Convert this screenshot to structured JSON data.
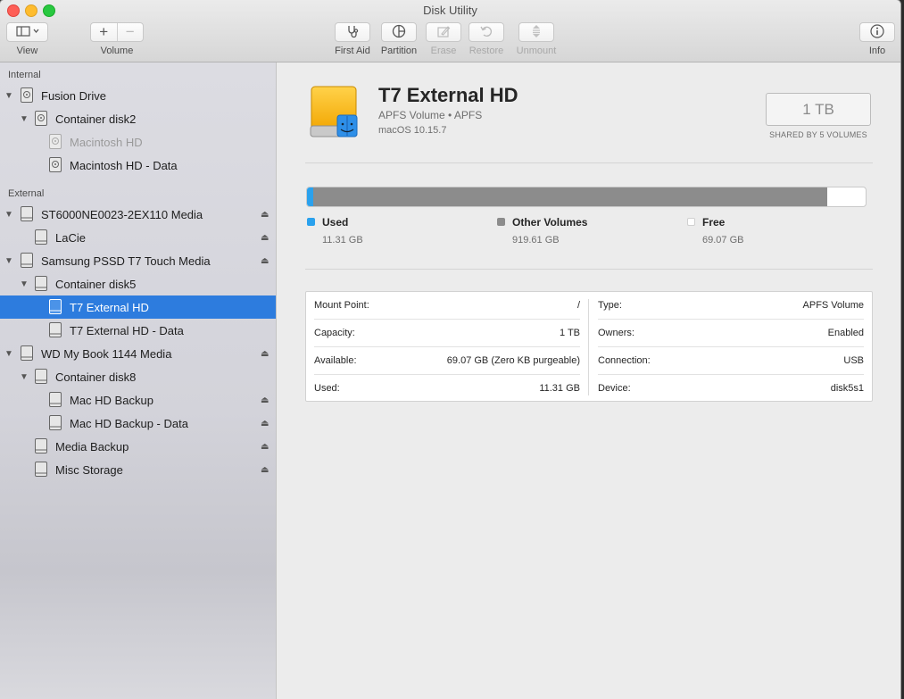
{
  "window": {
    "title": "Disk Utility"
  },
  "toolbar": {
    "view_label": "View",
    "volume_label": "Volume",
    "first_aid_label": "First Aid",
    "partition_label": "Partition",
    "erase_label": "Erase",
    "restore_label": "Restore",
    "unmount_label": "Unmount",
    "info_label": "Info"
  },
  "sidebar": {
    "internal_header": "Internal",
    "external_header": "External",
    "items": [
      {
        "label": "Fusion Drive"
      },
      {
        "label": "Container disk2"
      },
      {
        "label": "Macintosh HD"
      },
      {
        "label": "Macintosh HD - Data"
      },
      {
        "label": "ST6000NE0023-2EX110 Media"
      },
      {
        "label": "LaCie"
      },
      {
        "label": "Samsung PSSD T7 Touch Media"
      },
      {
        "label": "Container disk5"
      },
      {
        "label": "T7 External HD"
      },
      {
        "label": "T7 External HD - Data"
      },
      {
        "label": "WD My Book 1144 Media"
      },
      {
        "label": "Container disk8"
      },
      {
        "label": "Mac HD Backup"
      },
      {
        "label": "Mac HD Backup - Data"
      },
      {
        "label": "Media Backup"
      },
      {
        "label": "Misc Storage"
      }
    ]
  },
  "volume": {
    "name": "T7 External HD",
    "subtitle": "APFS Volume • APFS",
    "os": "macOS 10.15.7",
    "size": "1 TB",
    "shared": "SHARED BY 5 VOLUMES"
  },
  "usage": {
    "used": {
      "label": "Used",
      "value": "11.31 GB",
      "fraction": 0.0113,
      "color": "#2aa1ed"
    },
    "other": {
      "label": "Other Volumes",
      "value": "919.61 GB",
      "fraction": 0.9196,
      "color": "#8c8c8c"
    },
    "free": {
      "label": "Free",
      "value": "69.07 GB",
      "fraction": 0.0691,
      "color": "#ffffff"
    }
  },
  "info": {
    "left": [
      {
        "key": "Mount Point:",
        "value": "/"
      },
      {
        "key": "Capacity:",
        "value": "1 TB"
      },
      {
        "key": "Available:",
        "value": "69.07 GB (Zero KB purgeable)"
      },
      {
        "key": "Used:",
        "value": "11.31 GB"
      }
    ],
    "right": [
      {
        "key": "Type:",
        "value": "APFS Volume"
      },
      {
        "key": "Owners:",
        "value": "Enabled"
      },
      {
        "key": "Connection:",
        "value": "USB"
      },
      {
        "key": "Device:",
        "value": "disk5s1"
      }
    ]
  }
}
